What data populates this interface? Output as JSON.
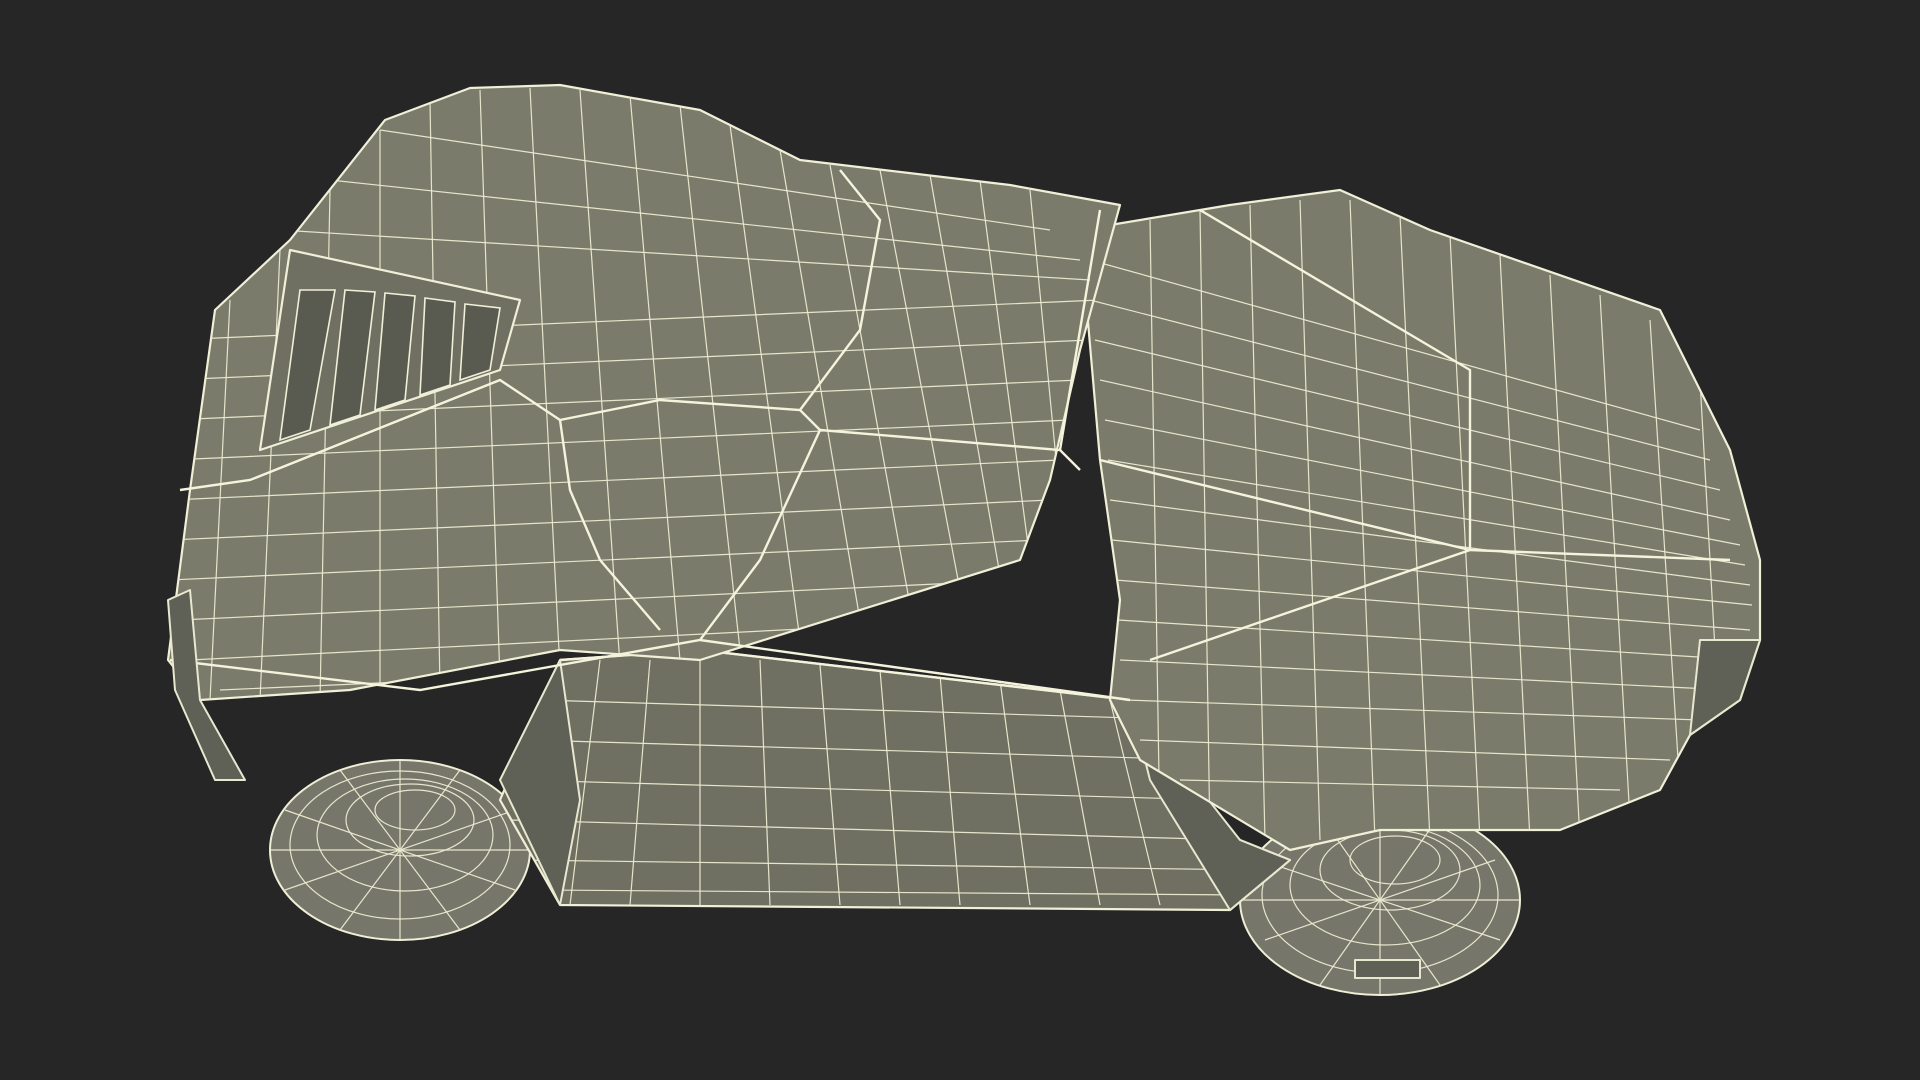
{
  "scene": {
    "subject": "robotic-lawn-mower-wireframe",
    "colors": {
      "background": "#262626",
      "surface": "#7a7b6b",
      "wireframe": "#f0efd8"
    }
  }
}
